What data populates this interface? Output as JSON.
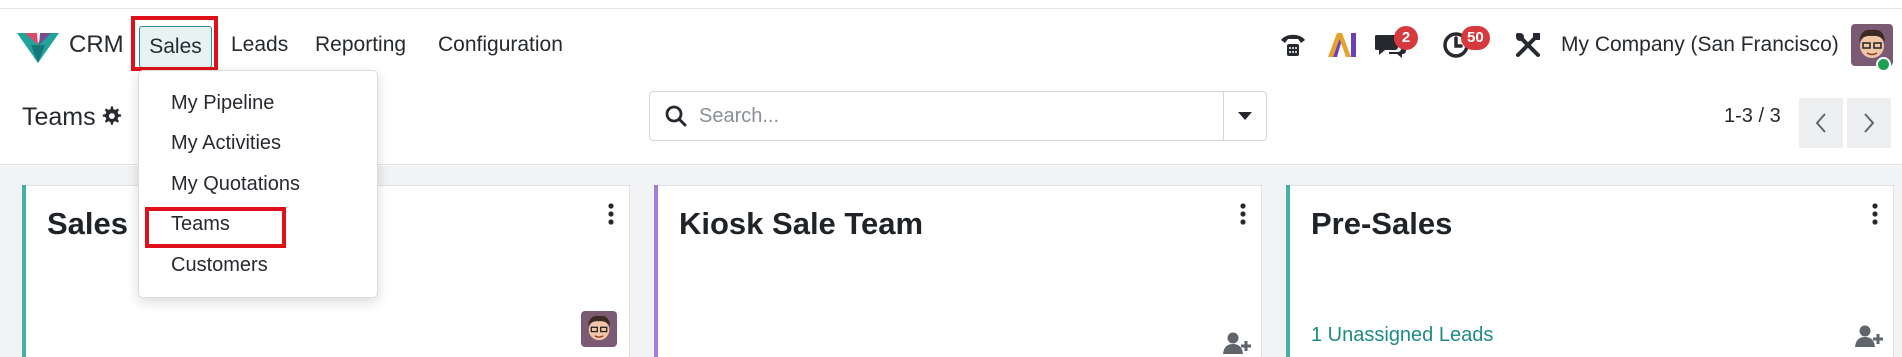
{
  "app": {
    "name": "CRM"
  },
  "nav": {
    "menus": [
      {
        "label": "Sales",
        "active": true
      },
      {
        "label": "Leads"
      },
      {
        "label": "Reporting"
      },
      {
        "label": "Configuration"
      }
    ]
  },
  "systray": {
    "icons": [
      "phone-icon",
      "ai-icon",
      "messages-icon",
      "activities-icon",
      "debug-tools-icon"
    ],
    "messages_badge": "2",
    "activities_badge": "50",
    "company": "My Company (San Francisco)"
  },
  "dropdown": {
    "items": [
      {
        "label": "My Pipeline"
      },
      {
        "label": "My Activities"
      },
      {
        "label": "My Quotations"
      },
      {
        "label": "Teams",
        "highlighted": true
      },
      {
        "label": "Customers"
      }
    ]
  },
  "control": {
    "title": "Teams",
    "search_placeholder": "Search...",
    "pager": "1-3 / 3"
  },
  "cards": [
    {
      "title": "Sales",
      "accent": "#3fb4a5",
      "link": ""
    },
    {
      "title": "Kiosk Sale Team",
      "accent": "#a27ce0",
      "link": ""
    },
    {
      "title": "Pre-Sales",
      "accent": "#3fb4a5",
      "link": "1 Unassigned Leads"
    }
  ],
  "colors": {
    "brand": "#714b67",
    "teal": "#1f8a86",
    "badge": "#d63a3e",
    "highlight_frame": "#e0101a"
  }
}
